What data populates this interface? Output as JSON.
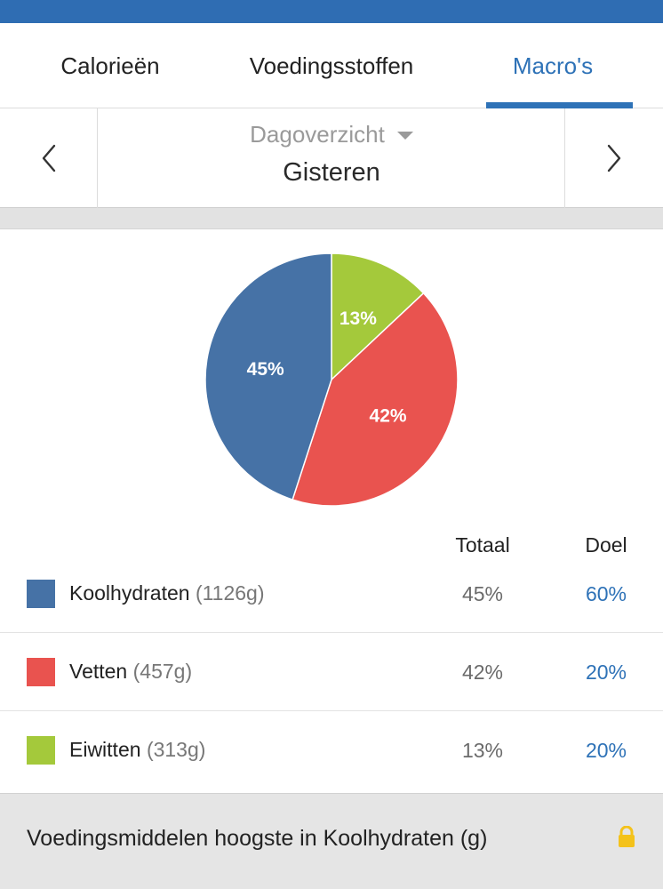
{
  "tabs": {
    "calories": "Calorieën",
    "nutrients": "Voedingsstoffen",
    "macros": "Macro's",
    "active": "macros"
  },
  "day_selector": {
    "range": "Dagoverzicht",
    "day": "Gisteren",
    "prev_icon": "chevron-left-icon",
    "next_icon": "chevron-right-icon"
  },
  "chart_data": {
    "type": "pie",
    "slices": [
      {
        "label": "Koolhydraten",
        "value": 45,
        "display": "45%",
        "color": "#4672a6"
      },
      {
        "label": "Vetten",
        "value": 42,
        "display": "42%",
        "color": "#e9534f"
      },
      {
        "label": "Eiwitten",
        "value": 13,
        "display": "13%",
        "color": "#a4c93b"
      }
    ],
    "start": "top",
    "direction": "clockwise",
    "slice_order": [
      2,
      1,
      0
    ]
  },
  "table": {
    "header_total": "Totaal",
    "header_goal": "Doel",
    "rows": [
      {
        "name": "Koolhydraten",
        "grams": "(1126g)",
        "total": "45%",
        "goal": "60%",
        "color": "#4672a6"
      },
      {
        "name": "Vetten",
        "grams": "(457g)",
        "total": "42%",
        "goal": "20%",
        "color": "#e9534f"
      },
      {
        "name": "Eiwitten",
        "grams": "(313g)",
        "total": "13%",
        "goal": "20%",
        "color": "#a4c93b"
      }
    ]
  },
  "footer": {
    "label": "Voedingsmiddelen hoogste in Koolhydraten (g)",
    "icon": "lock-icon",
    "icon_color": "#f4c21b"
  },
  "colors": {
    "accent": "#2e72b7",
    "topbar": "#2f6db3"
  }
}
